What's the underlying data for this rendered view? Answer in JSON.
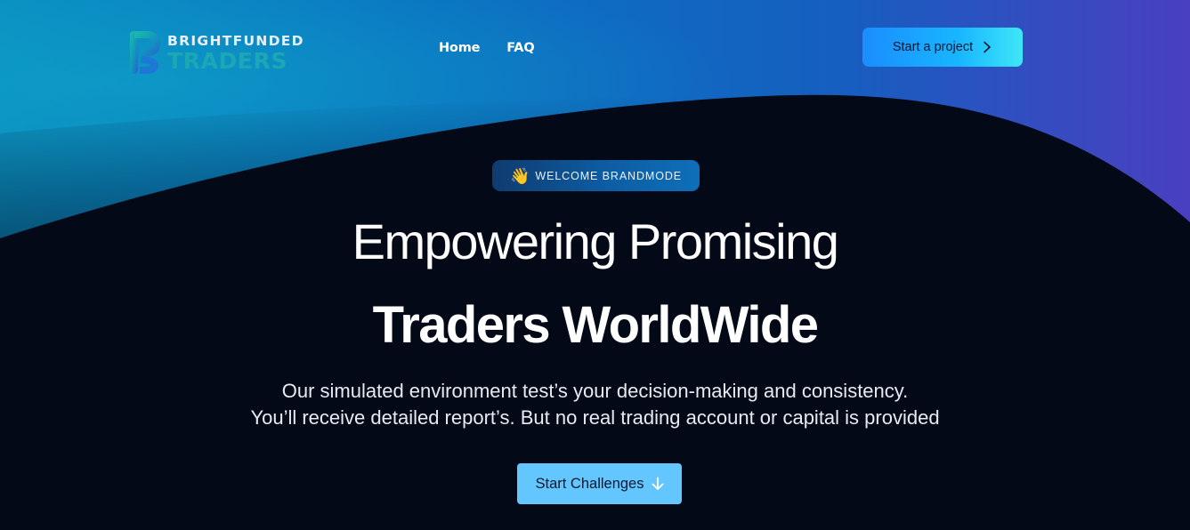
{
  "brand": {
    "line1": "BRIGHTFUNDED",
    "line2": "TRADERS"
  },
  "nav": {
    "items": [
      {
        "label": "Home"
      },
      {
        "label": "FAQ"
      }
    ]
  },
  "header": {
    "cta_label": "Start a project"
  },
  "hero": {
    "badge_emoji": "👋",
    "badge_text": "WELCOME BRANDMODE",
    "headline_line1": "Empowering Promising",
    "headline_line2": "Traders WorldWide",
    "sub_line1": "Our simulated environment test’s your decision-making and consistency.",
    "sub_line2": "You’ll receive detailed report’s. But no real trading account or capital is provided",
    "cta_label": "Start Challenges"
  },
  "colors": {
    "background": "#030917",
    "accent_cyan": "#63c6ff",
    "logo_teal": "#1ba7b6",
    "gradient_blue": "#0b78c4",
    "gradient_purple": "#3a3fb5"
  },
  "icons": {
    "cta_top": "chevron-right-icon",
    "cta_main": "arrow-down-icon",
    "badge": "waving-hand-icon"
  }
}
